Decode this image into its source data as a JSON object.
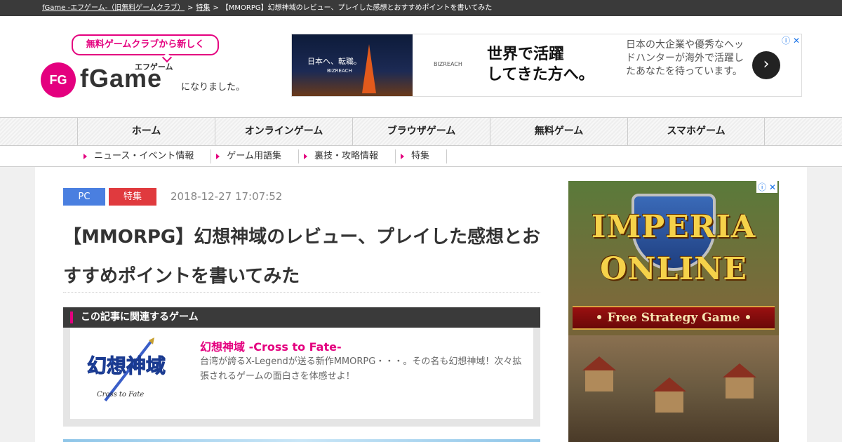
{
  "breadcrumb": {
    "home": "fGame -エフゲーム-（旧無料ゲームクラブ）",
    "section": "特集",
    "current": "【MMORPG】幻想神域のレビュー、プレイした感想とおすすめポイントを書いてみた",
    "separator": ">"
  },
  "logo": {
    "bubble": "無料ゲームクラブから新しく",
    "mark": "FG",
    "name": "fGame",
    "kana": "エフゲーム",
    "became": "になりました。"
  },
  "top_ad": {
    "image_text": "日本へ、転職。",
    "image_sub": "BIZREACH",
    "brand": "BIZREACH",
    "headline_1": "世界で活躍",
    "headline_2": "してきた方へ。",
    "description": "日本の大企業や優秀なヘッドハンターが海外で活躍したあなたを待っています。",
    "cta": "›",
    "marks": "ⓘ ✕"
  },
  "nav": {
    "items": [
      "ホーム",
      "オンラインゲーム",
      "ブラウザゲーム",
      "無料ゲーム",
      "スマホゲーム"
    ]
  },
  "subnav": {
    "items": [
      "ニュース・イベント情報",
      "ゲーム用語集",
      "裏技・攻略情報",
      "特集"
    ]
  },
  "article": {
    "tag_platform": "PC",
    "tag_category": "特集",
    "date": "2018-12-27 17:07:52",
    "title": "【MMORPG】幻想神域のレビュー、プレイした感想とおすすめポイントを書いてみた"
  },
  "related": {
    "heading": "この記事に関連するゲーム",
    "game_name": "幻想神域 -Cross to Fate-",
    "game_desc": "台湾が誇るX-Legendが送る新作MMORPG・・・。その名も幻想神域！次々拡張されるゲームの面白さを体感せよ！",
    "logo_title": "幻想神域",
    "logo_sub": "Cross to Fate"
  },
  "side_ad": {
    "title_1": "IMPERIA",
    "title_2": "ONLINE",
    "ribbon": "• Free Strategy Game •",
    "marks": "ⓘ ✕"
  },
  "colors": {
    "accent": "#e4007f",
    "tag_pc": "#4a7fe0",
    "tag_feature": "#e03a3e",
    "dark_bar": "#3a3a3a"
  }
}
